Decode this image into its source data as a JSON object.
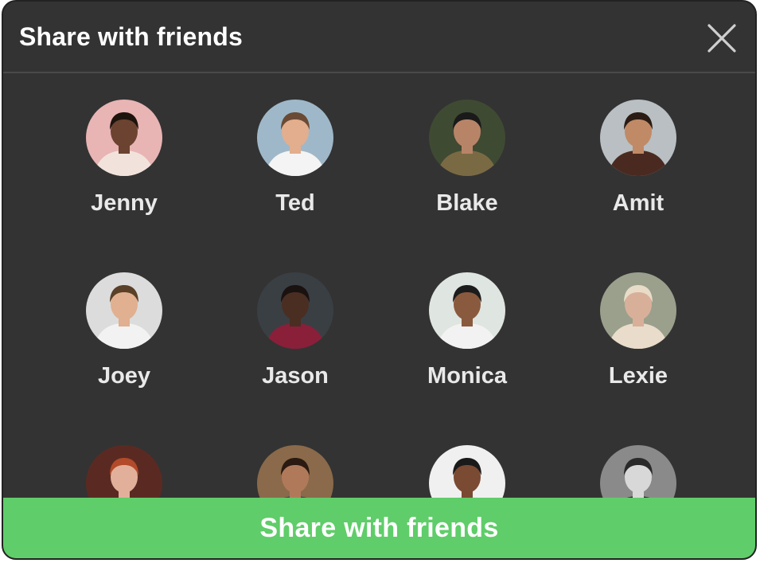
{
  "dialog": {
    "title": "Share with friends",
    "close_icon": "close-icon"
  },
  "friends": [
    {
      "name": "Jenny",
      "bg": "#e8b4b4",
      "skin": "#6b4330",
      "hair": "#1e140e",
      "shirt": "#f1e3dc"
    },
    {
      "name": "Ted",
      "bg": "#9fb8c9",
      "skin": "#e2ae8e",
      "hair": "#6a4a34",
      "shirt": "#f4f4f4"
    },
    {
      "name": "Blake",
      "bg": "#3f4a33",
      "skin": "#b88468",
      "hair": "#1a1a1a",
      "shirt": "#7a6a44"
    },
    {
      "name": "Amit",
      "bg": "#b9bfc2",
      "skin": "#c08a66",
      "hair": "#2a1c14",
      "shirt": "#4a2a20"
    },
    {
      "name": "Joey",
      "bg": "#dcdcdc",
      "skin": "#e0b090",
      "hair": "#5a4028",
      "shirt": "#f2f2f2"
    },
    {
      "name": "Jason",
      "bg": "#3a3f44",
      "skin": "#4a2e22",
      "hair": "#1a1210",
      "shirt": "#8a1f3a"
    },
    {
      "name": "Monica",
      "bg": "#dfe5e0",
      "skin": "#8a5a3e",
      "hair": "#1c1c1c",
      "shirt": "#f2f2f2"
    },
    {
      "name": "Lexie",
      "bg": "#9aa08c",
      "skin": "#d8b09a",
      "hair": "#e8dcc8",
      "shirt": "#e9dccb"
    },
    {
      "name": "",
      "bg": "#5a2a22",
      "skin": "#e2b09a",
      "hair": "#b34a2a",
      "shirt": "#5a2a22"
    },
    {
      "name": "",
      "bg": "#8a6a4a",
      "skin": "#b07a5a",
      "hair": "#2a1a12",
      "shirt": "#2f4a66"
    },
    {
      "name": "",
      "bg": "#f0f0f0",
      "skin": "#7a4a32",
      "hair": "#1a1a1a",
      "shirt": "#e9e9e9"
    },
    {
      "name": "",
      "bg": "#8a8a8a",
      "skin": "#d8d8d8",
      "hair": "#2a2a2a",
      "shirt": "#2a2a2a"
    }
  ],
  "footer": {
    "share_label": "Share with friends"
  }
}
